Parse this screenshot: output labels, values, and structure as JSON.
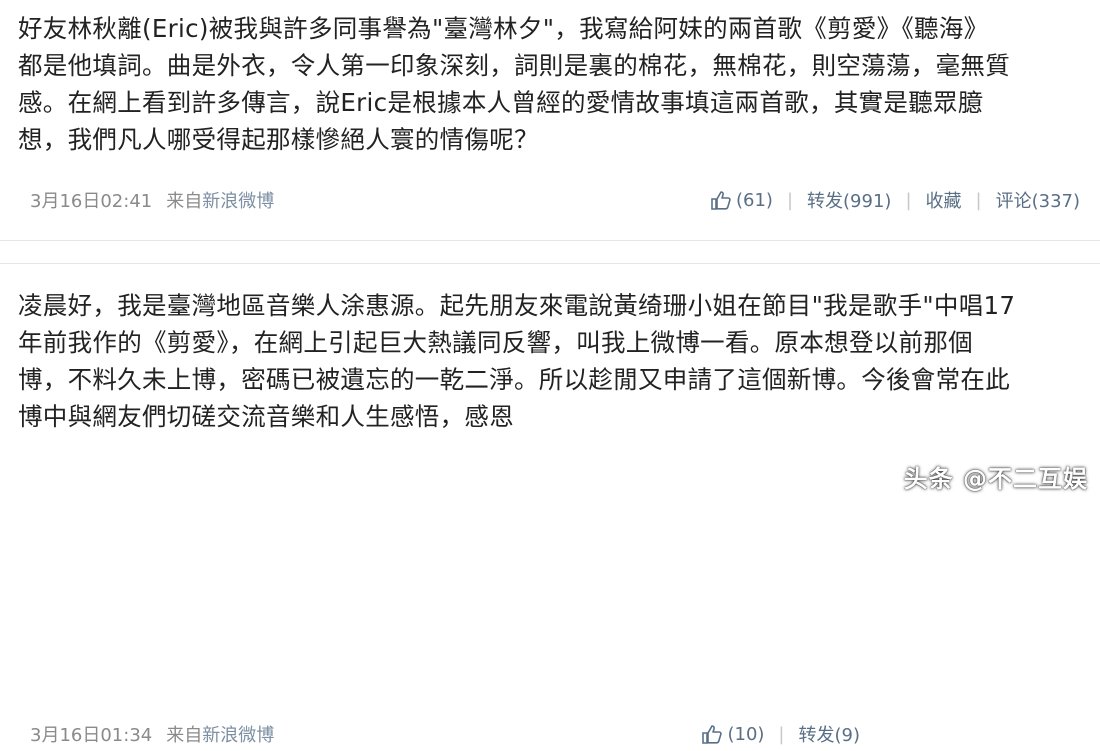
{
  "posts": [
    {
      "lines": [
        "好友林秋離(Eric)被我與許多同事譽為\"臺灣林夕\"，我寫給阿妹的兩首歌《剪愛》《聽海》",
        "都是他填詞。曲是外衣，令人第一印象深刻，詞則是裏的棉花，無棉花，則空蕩蕩，毫無質",
        "感。在網上看到許多傳言，說Eric是根據本人曾經的愛情故事填這兩首歌，其實是聽眾臆",
        "想，我們凡人哪受得起那樣慘絕人寰的情傷呢？"
      ],
      "time": "3月16日02:41",
      "source_prefix": "来自",
      "source_app": "新浪微博",
      "like_count": "(61)",
      "repost": "转发(991)",
      "favorite": "收藏",
      "comment": "评论(337)"
    },
    {
      "lines": [
        "凌晨好，我是臺灣地區音樂人涂惠源。起先朋友來電說黃绮珊小姐在節目\"我是歌手\"中唱17",
        "年前我作的《剪愛》，在網上引起巨大熱議同反響，叫我上微博一看。原本想登以前那個",
        "博，不料久未上博，密碼已被遺忘的一乾二淨。所以趁閒又申請了這個新博。今後會常在此",
        "博中與網友們切磋交流音樂和人生感悟，感恩"
      ],
      "time": "3月16日01:34",
      "source_prefix": "来自",
      "source_app": "新浪微博",
      "like_count": "(10)",
      "repost": "转发(9)"
    }
  ],
  "watermark": "头条 @不二互娱",
  "colors": {
    "text": "#222222",
    "meta": "#8a8a8a",
    "action": "#5a6f86"
  }
}
